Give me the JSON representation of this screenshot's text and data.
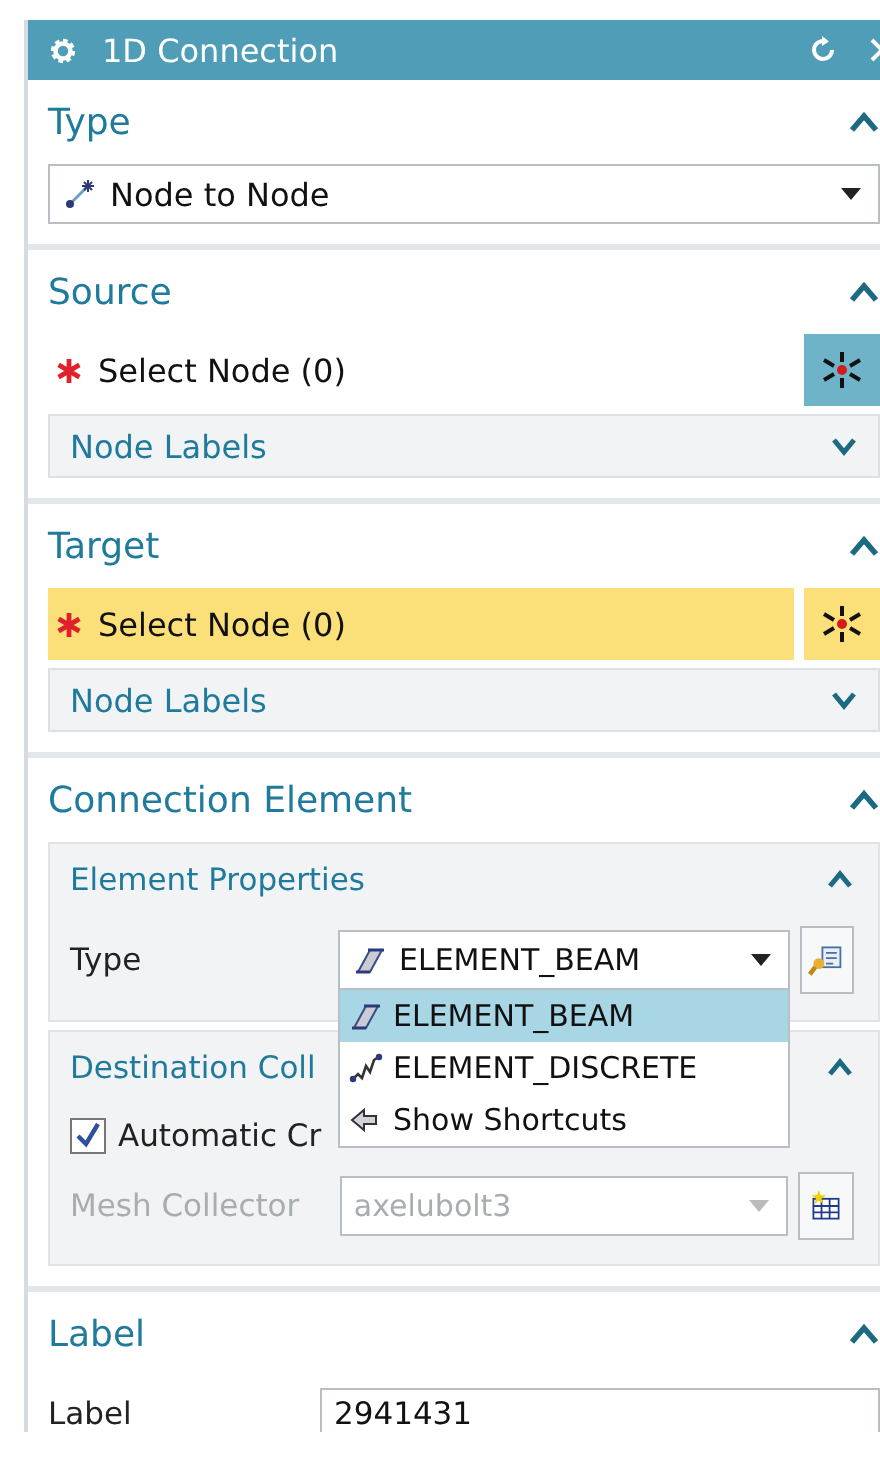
{
  "window": {
    "title": "1D Connection"
  },
  "type_section": {
    "title": "Type",
    "expanded": true,
    "dropdown": {
      "value": "Node to Node"
    }
  },
  "source": {
    "title": "Source",
    "expanded": true,
    "select": {
      "label": "Select Node (0)",
      "required": true,
      "active": false
    },
    "node_labels": {
      "label": "Node Labels",
      "expanded": false
    }
  },
  "target": {
    "title": "Target",
    "expanded": true,
    "select": {
      "label": "Select Node (0)",
      "required": true,
      "active": true
    },
    "node_labels": {
      "label": "Node Labels",
      "expanded": false
    }
  },
  "connection_element": {
    "title": "Connection Element",
    "expanded": true,
    "element_properties": {
      "title": "Element Properties",
      "expanded": true,
      "type_label": "Type",
      "type_value": "ELEMENT_BEAM",
      "dropdown_open": true,
      "options": [
        {
          "label": "ELEMENT_BEAM",
          "kind": "beam",
          "selected": true
        },
        {
          "label": "ELEMENT_DISCRETE",
          "kind": "spring",
          "selected": false
        },
        {
          "label": "Show Shortcuts",
          "kind": "shortcuts",
          "selected": false
        }
      ]
    },
    "destination_collector": {
      "title": "Destination Coll",
      "expanded": true,
      "automatic": {
        "label": "Automatic Cr",
        "checked": true
      },
      "mesh_collector": {
        "label": "Mesh Collector",
        "value": "axelubolt3",
        "disabled": true
      }
    }
  },
  "label_section": {
    "title": "Label",
    "expanded": true,
    "field": {
      "label": "Label",
      "value": "2941431"
    }
  }
}
